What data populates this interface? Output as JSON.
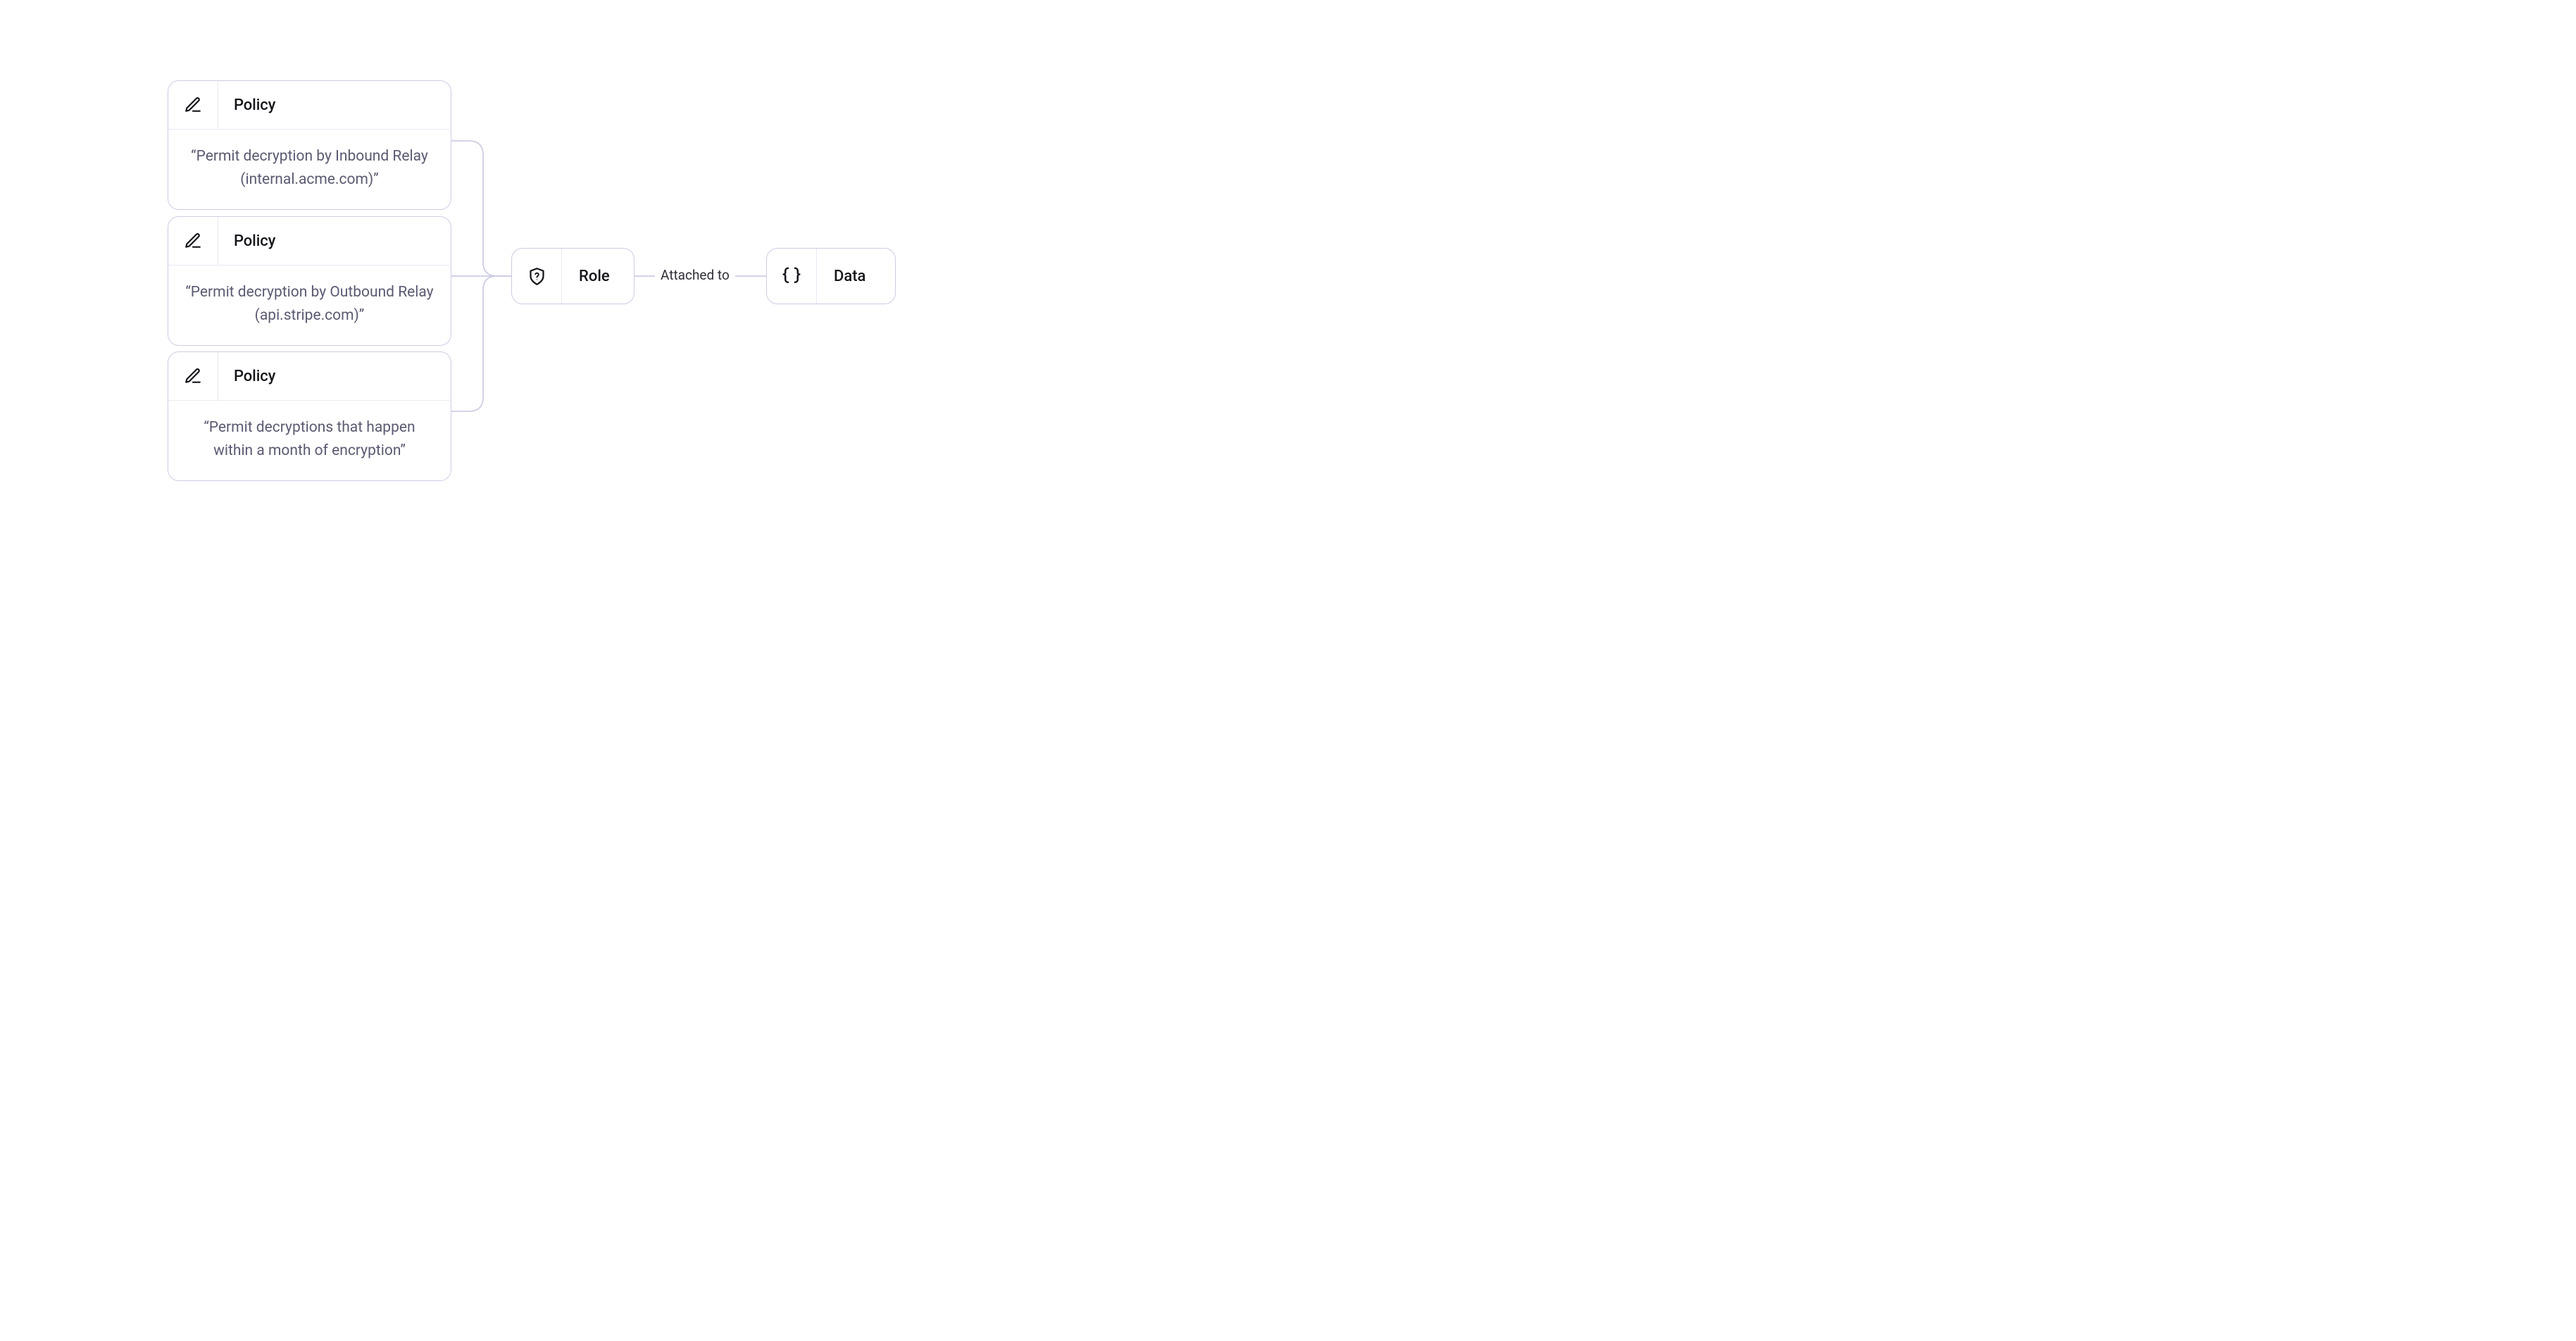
{
  "policies": [
    {
      "label": "Policy",
      "text": "“Permit decryption by Inbound Relay (internal.acme.com)”"
    },
    {
      "label": "Policy",
      "text": "“Permit decryption by Outbound Relay (api.stripe.com)”"
    },
    {
      "label": "Policy",
      "text": "“Permit decryptions that happen within a month of encryption”"
    }
  ],
  "role": {
    "label": "Role"
  },
  "relation": {
    "label": "Attached to"
  },
  "data": {
    "label": "Data"
  }
}
